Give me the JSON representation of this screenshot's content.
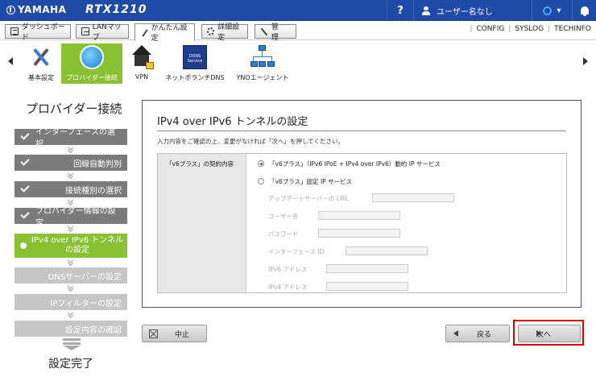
{
  "header": {
    "brand": "YAMAHA",
    "model": "RTX1210",
    "help": "?",
    "user": "ユーザー名なし",
    "status_caret": "▾"
  },
  "tabs": [
    {
      "label": "ダッシュボード",
      "icon": "dashboard-icon"
    },
    {
      "label": "LANマップ",
      "icon": "lan-map-icon"
    },
    {
      "label": "かんたん設定",
      "icon": "wand-icon",
      "active": true
    },
    {
      "label": "詳細設定",
      "icon": "gear-icon"
    },
    {
      "label": "管　理",
      "icon": "wrench-icon"
    }
  ],
  "links": [
    "CONFIG",
    "SYSLOG",
    "TECHINFO"
  ],
  "wizard_icons": [
    {
      "label": "基本設定",
      "icon": "tools-icon"
    },
    {
      "label": "プロバイダー接続",
      "icon": "globe-icon",
      "active": true
    },
    {
      "label": "VPN",
      "icon": "vpn-house-icon"
    },
    {
      "label": "ネットボランチDNS",
      "icon": "ddns-icon",
      "badge": "DDNS Service"
    },
    {
      "label": "YNOエージェント",
      "icon": "network-icon"
    }
  ],
  "steps": {
    "title": "プロバイダー接続",
    "items": [
      {
        "label": "インターフェースの選択",
        "state": "done"
      },
      {
        "label": "回線自動判別",
        "state": "done"
      },
      {
        "label": "接続種別の選択",
        "state": "done"
      },
      {
        "label": "プロバイダー情報の設定",
        "state": "done"
      },
      {
        "label_1": "IPv4 over IPv6 トンネル",
        "label_2": "の設定",
        "state": "current"
      },
      {
        "label": "DNSサーバーの設定",
        "state": "todo"
      },
      {
        "label": "IPフィルターの設定",
        "state": "todo"
      },
      {
        "label": "設定内容の確認",
        "state": "todo"
      }
    ],
    "finish": "設定完了"
  },
  "panel": {
    "title": "IPv4 over IPv6 トンネルの設定",
    "instruction": "入力内容をご確認の上、変更がなければ「次へ」を押してください。",
    "row_label": "「v6プラス」の契約内容",
    "options": [
      {
        "label": "「v6プラス」（IPv6 IPoE + IPv4 over IPv6）動的 IP サービス",
        "selected": true
      },
      {
        "label": "「v6プラス」固定 IP サービス",
        "selected": false
      }
    ],
    "fields": [
      {
        "label": "アップデートサーバーの URL",
        "value": ""
      },
      {
        "label": "ユーザー名",
        "value": ""
      },
      {
        "label": "パスワード",
        "value": ""
      },
      {
        "label": "インターフェース ID",
        "value": ""
      },
      {
        "label": "IPv6 アドレス",
        "value": ""
      },
      {
        "label": "IPv4 アドレス",
        "value": ""
      }
    ]
  },
  "buttons": {
    "cancel": "中止",
    "back": "戻る",
    "next": "次へ"
  },
  "colors": {
    "header_blue": "#1f4aa8",
    "active_green": "#88c233",
    "step_done": "#7b7b7b",
    "step_todo": "#c6c6c6",
    "highlight_red": "#e00000"
  }
}
